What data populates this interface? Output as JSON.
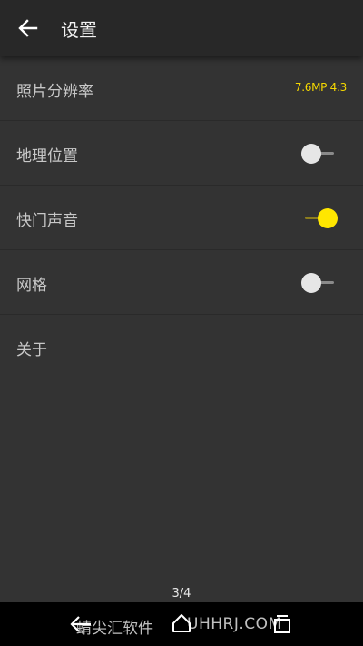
{
  "header": {
    "title": "设置",
    "back_icon": "arrow-left-icon"
  },
  "settings": {
    "resolution": {
      "label": "照片分辨率",
      "value": "7.6MP 4:3"
    },
    "location": {
      "label": "地理位置",
      "enabled": false
    },
    "shutter_sound": {
      "label": "快门声音",
      "enabled": true
    },
    "grid": {
      "label": "网格",
      "enabled": false
    },
    "about": {
      "label": "关于"
    }
  },
  "page_indicator": "3/4",
  "watermark": {
    "left": "蜻尖汇软件",
    "right": "UHHRJ.COM"
  },
  "colors": {
    "accent": "#ffe600",
    "background": "#333333",
    "toolbar": "#282828",
    "navbar": "#000000"
  }
}
